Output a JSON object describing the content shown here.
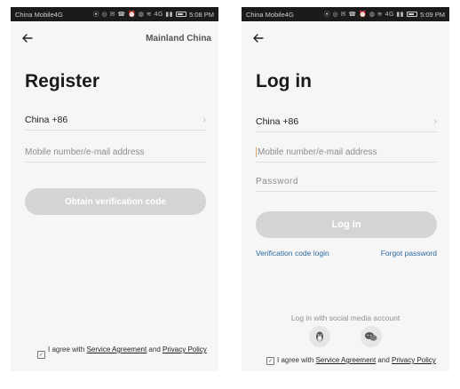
{
  "register": {
    "status": {
      "carrier": "China Mobile4G",
      "icons": "⦿ ◎ ✉ ☎ ⏰ ◍ ≋ 4G ▮▮",
      "time": "5:08 PM"
    },
    "region": "Mainland China",
    "title": "Register",
    "country": "China +86",
    "account_placeholder": "Mobile number/e-mail address",
    "obtain_code_label": "Obtain verification code",
    "agree_prefix": "I agree with",
    "service_agreement": "Service Agreement",
    "and": "and",
    "privacy_policy": "Privacy Policy"
  },
  "login": {
    "status": {
      "carrier": "China Mobile4G",
      "icons": "⦿ ◎ ✉ ☎ ⏰ ◍ ≋ 4G ▮▮",
      "time": "5:09 PM"
    },
    "title": "Log in",
    "country": "China +86",
    "account_placeholder": "Mobile number/e-mail address",
    "password_placeholder": "Password",
    "login_label": "Log in",
    "verification_login": "Verification code login",
    "forgot_password": "Forgot password",
    "social_label": "Log in with social media account",
    "agree_prefix": "I agree with",
    "service_agreement": "Service Agreement",
    "and": "and",
    "privacy_policy": "Privacy Policy"
  },
  "icons": {
    "back": "arrow-left-icon",
    "chevron": "chevron-right-icon",
    "qq": "qq-penguin-icon",
    "wechat": "wechat-icon",
    "checkbox": "checkbox-checked-icon"
  },
  "colors": {
    "button_disabled": "#d4d4d4",
    "link": "#2d6aa0",
    "background": "#f6f6f6"
  }
}
